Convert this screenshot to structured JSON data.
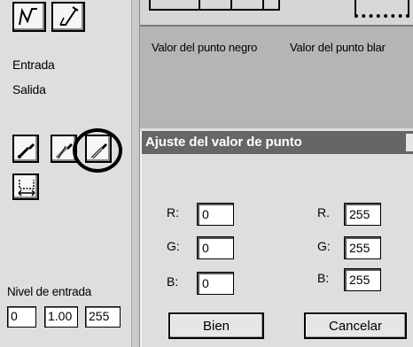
{
  "curve_tools": [
    "curve-tool-icon",
    "pencil-tool-icon"
  ],
  "channel_labels": {
    "input": "Entrada",
    "output": "Salida"
  },
  "eyedroppers": {
    "black_point": "black-eyedropper-icon",
    "gray_point": "gray-eyedropper-icon",
    "white_point": "white-eyedropper-icon"
  },
  "input_level": {
    "label": "Nivel de entrada",
    "black": "0",
    "gamma": "1.00",
    "white": "255"
  },
  "dialog": {
    "title": "Ajuste del valor de punto",
    "black_heading": "Valor del punto negro",
    "white_heading": "Valor del punto blar",
    "black_point": {
      "r_label": "R:",
      "r": "0",
      "g_label": "G:",
      "g": "0",
      "b_label": "B:",
      "b": "0"
    },
    "white_point": {
      "r_label": "R.",
      "r": "255",
      "g_label": "G:",
      "g": "255",
      "b_label": "B:",
      "b": "255"
    },
    "ok_label": "Bien",
    "cancel_label": "Cancelar"
  },
  "colors": {
    "titlebar": "#666666",
    "panel": "#dedede",
    "preview": "#b5b5b5"
  }
}
